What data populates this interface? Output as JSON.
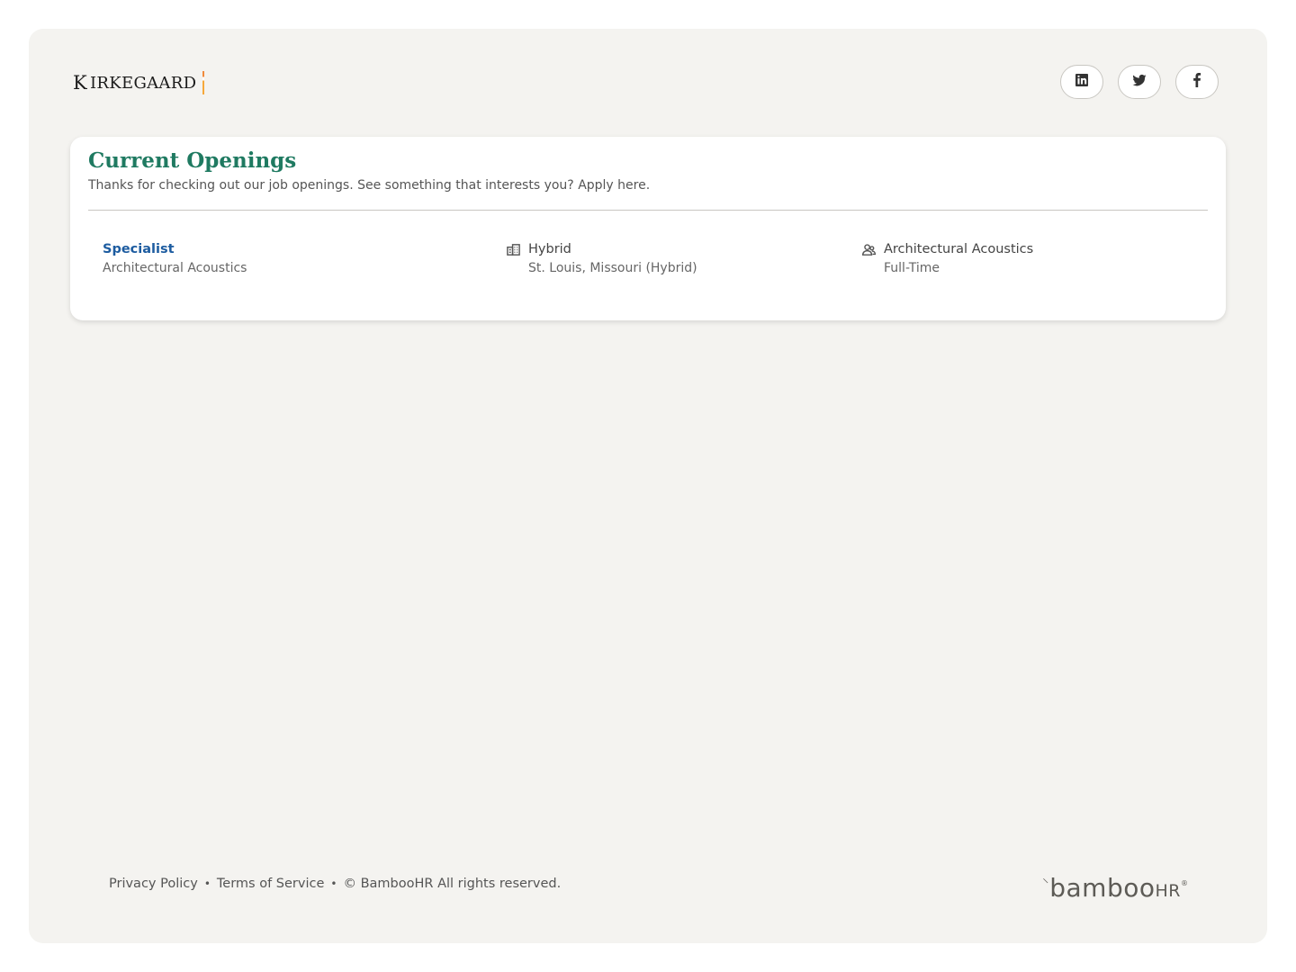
{
  "header": {
    "logo_initial": "K",
    "logo_rest": "IRKEGAARD",
    "social": [
      {
        "name": "linkedin-icon"
      },
      {
        "name": "twitter-icon"
      },
      {
        "name": "facebook-icon"
      }
    ]
  },
  "openings": {
    "title": "Current Openings",
    "subtitle": "Thanks for checking out our job openings. See something that interests you? Apply here.",
    "jobs": [
      {
        "title": "Specialist",
        "department": "Architectural Acoustics",
        "location_type": "Hybrid",
        "location": "St. Louis, Missouri (Hybrid)",
        "team": "Architectural Acoustics",
        "employment_type": "Full-Time"
      }
    ]
  },
  "footer": {
    "privacy": "Privacy Policy",
    "terms": "Terms of Service",
    "separator": "•",
    "copyright": "© BambooHR All rights reserved.",
    "brand_word": "bamboo",
    "brand_hr": "HR",
    "brand_tm": "®"
  },
  "colors": {
    "accent_heading": "#1f7a61",
    "job_link": "#1d5ca0",
    "page_bg": "#f4f3f0"
  }
}
